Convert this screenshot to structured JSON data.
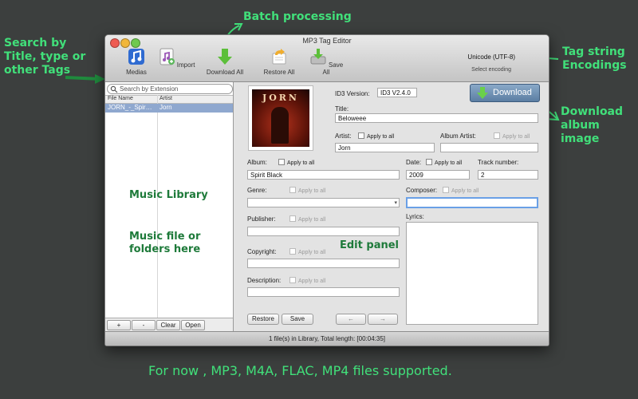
{
  "annotations": {
    "search": "Search by Title, type or other Tags",
    "batch": "Batch processing",
    "encodings": "Tag string Encodings",
    "download_image": "Download album image",
    "music_library": "Music Library",
    "music_files": "Music file or folders here",
    "edit_panel": "Edit panel",
    "supported": "For now , MP3, M4A, FLAC, MP4 files supported."
  },
  "window": {
    "title": "MP3 Tag Editor",
    "toolbar": {
      "medias": "Medias",
      "import": "Import",
      "download_all": "Download All",
      "restore_all": "Restore All",
      "save_all": "Save All"
    },
    "encoding": {
      "value": "Unicode (UTF-8)",
      "label": "Select encoding"
    }
  },
  "library": {
    "search_placeholder": "Search by Extension",
    "col_file_name": "File Name",
    "col_artist": "Artist",
    "rows": [
      {
        "file_name": "JORN_-_Spir…",
        "artist": "Jorn"
      }
    ],
    "buttons": {
      "add": "+",
      "remove": "-",
      "clear": "Clear",
      "open": "Open"
    }
  },
  "editor": {
    "cover_text": "JORN",
    "id3_version_label": "ID3 Version:",
    "id3_version_value": "ID3 V2.4.0",
    "download_button": "Download",
    "apply_to_all": "Apply to all",
    "title_label": "Title:",
    "title_value": "Beloweee",
    "artist_label": "Artist:",
    "artist_value": "Jorn",
    "album_artist_label": "Album Artist:",
    "album_artist_value": "",
    "album_label": "Album:",
    "album_value": "Spirit Black",
    "date_label": "Date:",
    "date_value": "2009",
    "track_label": "Track number:",
    "track_value": "2",
    "genre_label": "Genre:",
    "genre_value": "",
    "composer_label": "Composer:",
    "composer_value": "",
    "publisher_label": "Publisher:",
    "publisher_value": "",
    "lyrics_label": "Lyrics:",
    "copyright_label": "Copyright:",
    "copyright_value": "",
    "description_label": "Description:",
    "description_value": "",
    "restore_button": "Restore",
    "save_button": "Save",
    "prev_arrow": "←",
    "next_arrow": "→"
  },
  "status": "1 file(s) in Library, Total length: [00:04:35]",
  "colors": {
    "annotation_bright": "#41e07a",
    "annotation_dark": "#1e7a3a",
    "background": "#3c3f3e"
  }
}
